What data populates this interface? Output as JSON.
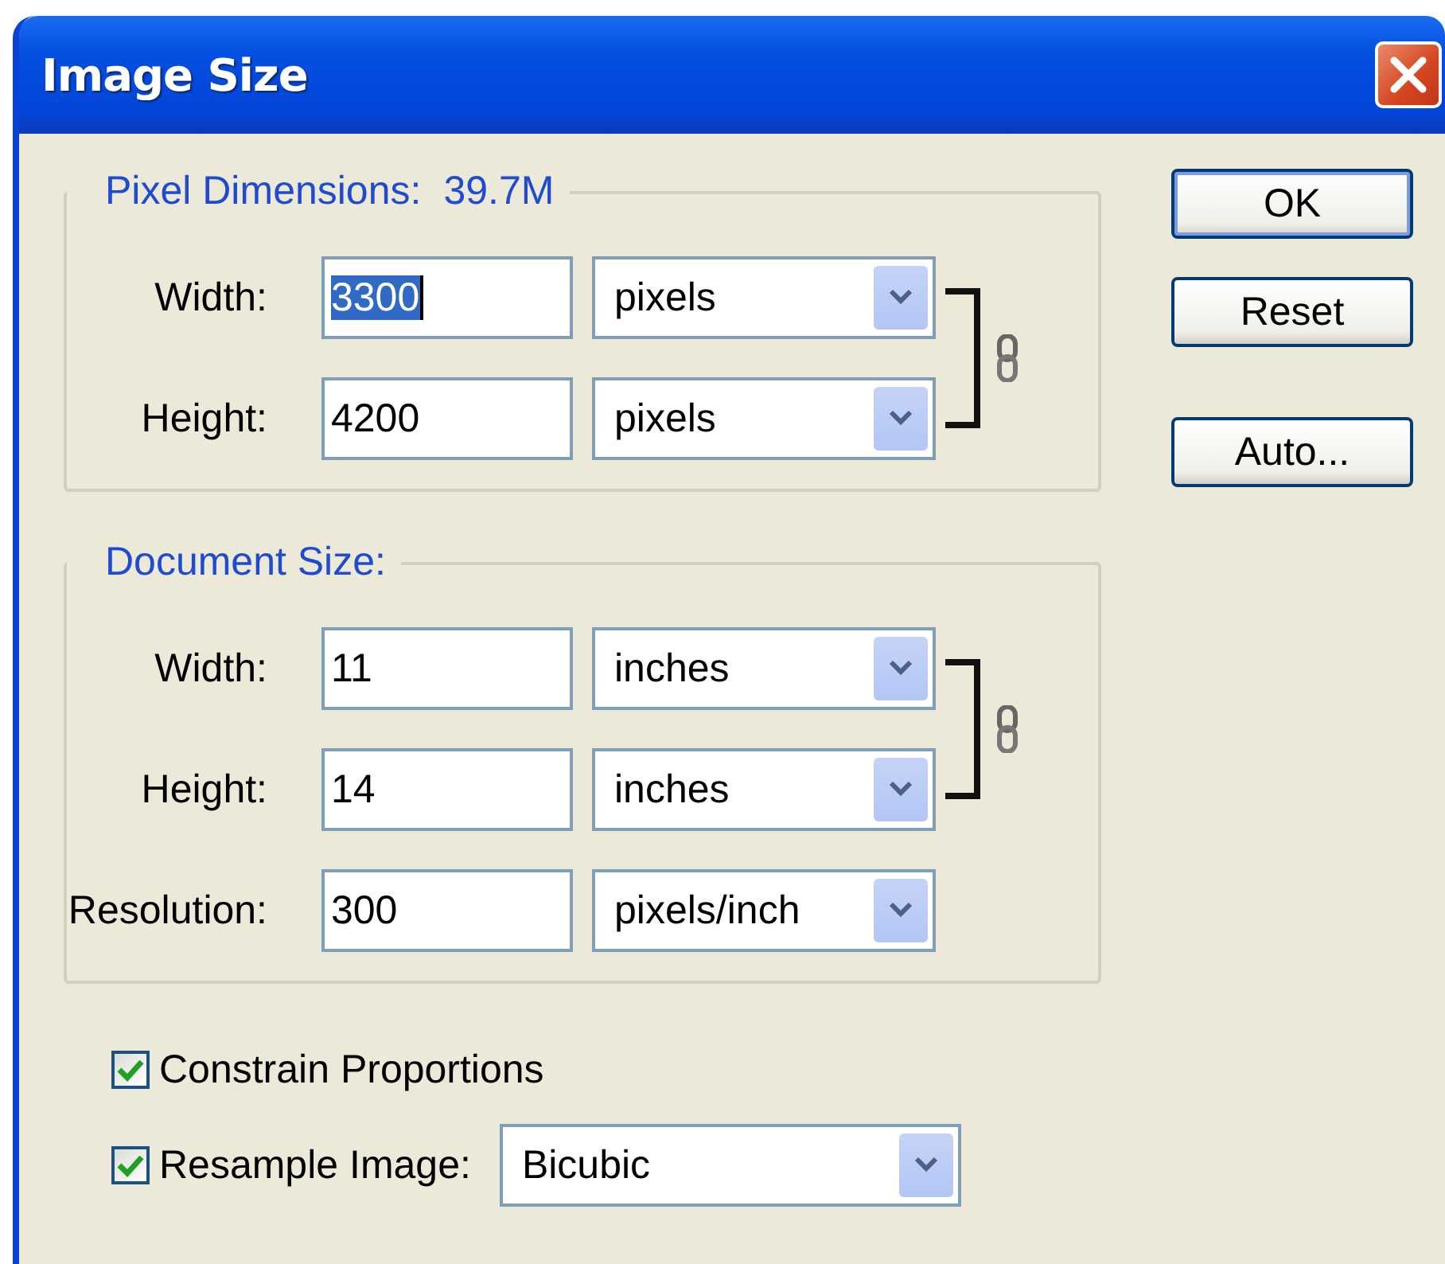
{
  "window": {
    "title": "Image Size"
  },
  "groups": [
    {
      "title": "Pixel Dimensions:",
      "value": "39.7M",
      "rows": [
        {
          "label": "Width:",
          "value": "3300",
          "selected": true,
          "unit": "pixels",
          "linked": true
        },
        {
          "label": "Height:",
          "value": "4200",
          "selected": false,
          "unit": "pixels",
          "linked": true
        }
      ]
    },
    {
      "title": "Document Size:",
      "rows": [
        {
          "label": "Width:",
          "value": "11",
          "selected": false,
          "unit": "inches",
          "linked": true
        },
        {
          "label": "Height:",
          "value": "14",
          "selected": false,
          "unit": "inches",
          "linked": true
        },
        {
          "label": "Resolution:",
          "value": "300",
          "selected": false,
          "unit": "pixels/inch",
          "linked": false
        }
      ]
    }
  ],
  "options": [
    {
      "label": "Constrain Proportions",
      "checked": true
    },
    {
      "label": "Resample Image:",
      "checked": true,
      "dropdown": "Bicubic"
    }
  ],
  "buttons": [
    {
      "label": "OK",
      "default": true
    },
    {
      "label": "Reset",
      "default": false
    },
    {
      "label": "Auto...",
      "default": false
    }
  ]
}
